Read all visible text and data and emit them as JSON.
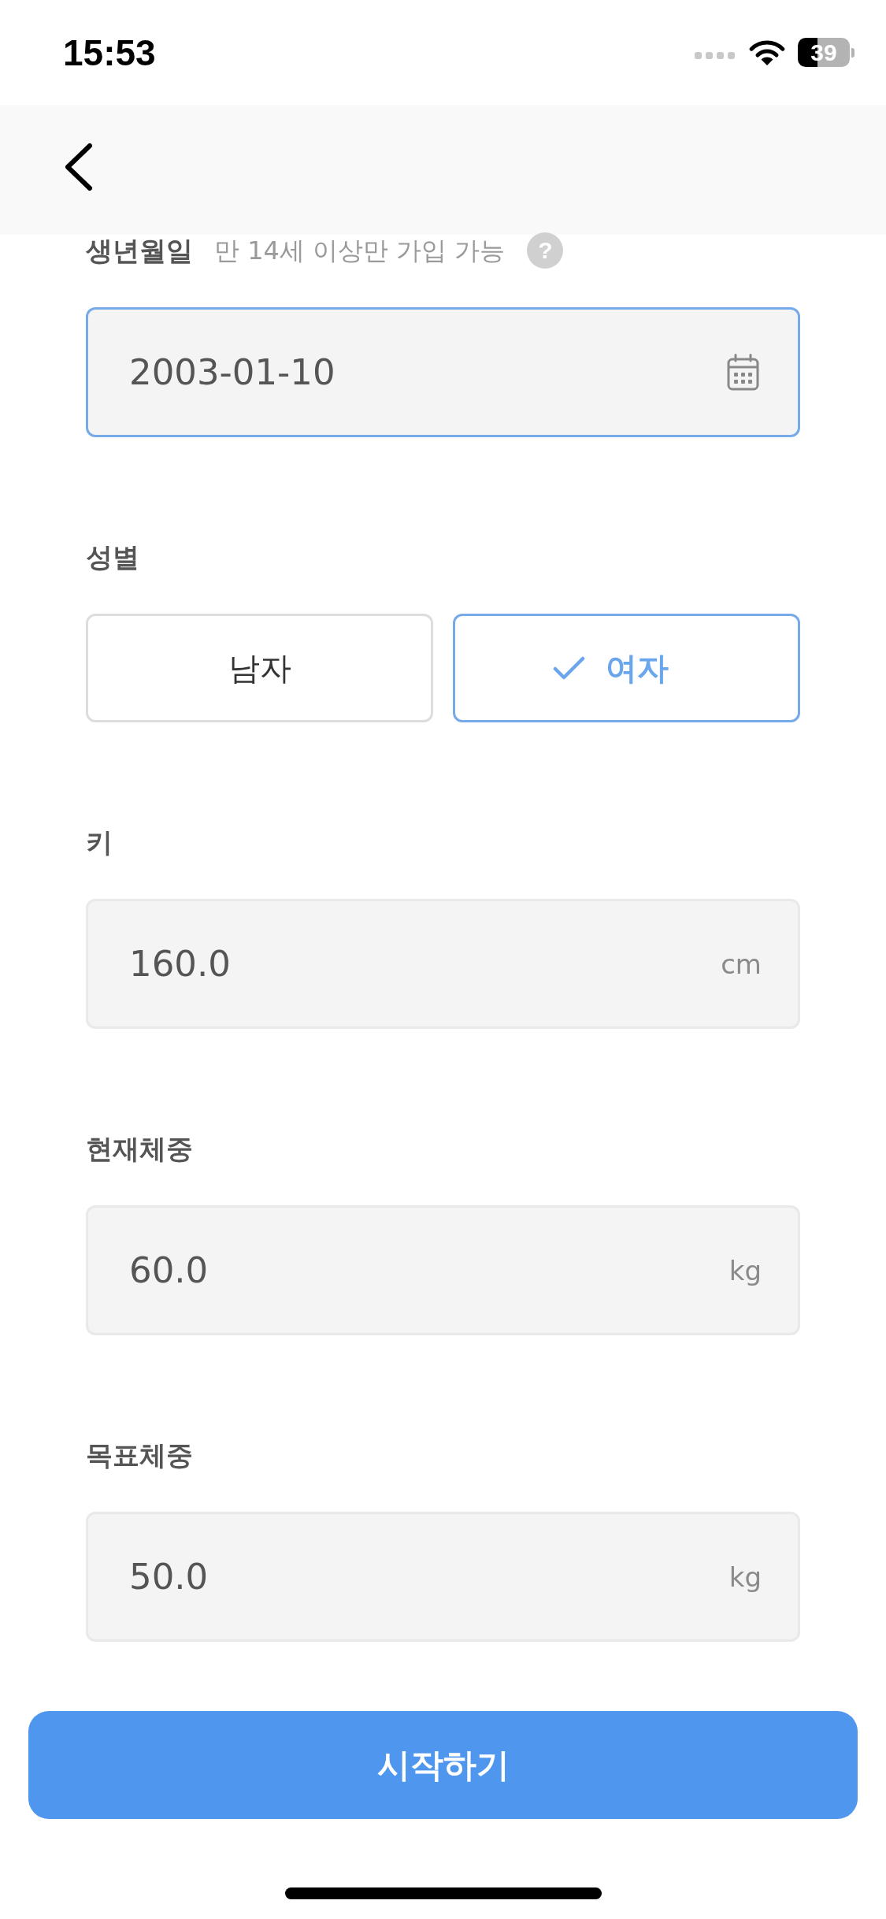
{
  "status_bar": {
    "time": "15:53",
    "battery": "39"
  },
  "birthdate": {
    "label": "생년월일",
    "hint": "만 14세 이상만 가입 가능",
    "help": "?",
    "value": "2003-01-10",
    "focused": true
  },
  "gender": {
    "label": "성별",
    "options": [
      {
        "label": "남자",
        "selected": false
      },
      {
        "label": "여자",
        "selected": true
      }
    ]
  },
  "measurements": [
    {
      "label": "키",
      "value": "160.0",
      "unit": "cm",
      "focused": false
    },
    {
      "label": "현재체중",
      "value": "60.0",
      "unit": "kg",
      "focused": false
    },
    {
      "label": "목표체중",
      "value": "50.0",
      "unit": "kg",
      "focused": false
    }
  ],
  "start_button": {
    "label": "시작하기"
  }
}
